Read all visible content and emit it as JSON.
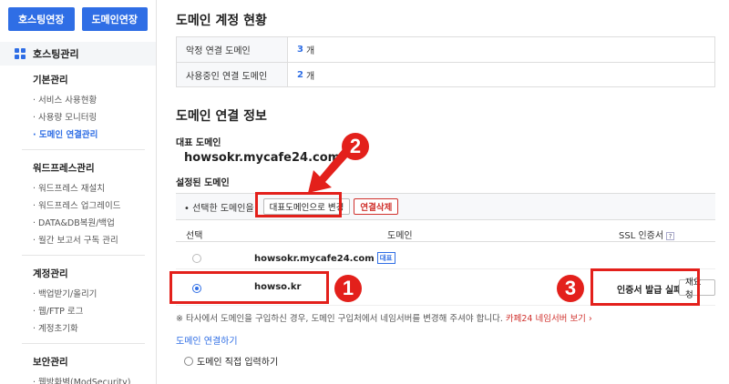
{
  "top_buttons": {
    "hosting_extend": "호스팅연장",
    "domain_extend": "도메인연장"
  },
  "sidebar": {
    "header": "호스팅관리",
    "groups": [
      {
        "title": "기본관리",
        "items": [
          "· 서비스 사용현황",
          "· 사용량 모니터링",
          "· 도메인 연결관리"
        ],
        "active": 2
      },
      {
        "title": "워드프레스관리",
        "items": [
          "· 워드프레스 재설치",
          "· 워드프레스 업그레이드",
          "· DATA&DB복원/백업",
          "· 월간 보고서 구독 관리"
        ]
      },
      {
        "title": "계정관리",
        "items": [
          "· 백업받기/올리기",
          "· 웹/FTP 로그",
          "· 계정초기화"
        ]
      },
      {
        "title": "보안관리",
        "items": [
          "· 웹방화벽(ModSecurity)"
        ]
      }
    ]
  },
  "status": {
    "title": "도메인 계정 현황",
    "rows": [
      {
        "label": "악정 연결 도메인",
        "count": "3",
        "unit": "개"
      },
      {
        "label": "사용중인 연결 도메인",
        "count": "2",
        "unit": "개"
      }
    ]
  },
  "info": {
    "title": "도메인 연결 정보",
    "primary_label": "대표 도메인",
    "primary_domain": "howsokr.mycafe24.com",
    "configured_label": "설정된 도메인",
    "action_prefix": "• 선택한 도메인을",
    "btn_make_primary": "대표도메인으로 변경",
    "btn_delete": "연결삭제",
    "columns": {
      "select": "선택",
      "domain": "도메인",
      "ssl": "SSL 인증서"
    },
    "ssl_help": "?",
    "rows": [
      {
        "domain": "howsokr.mycafe24.com",
        "badge": "대표",
        "selected": false
      },
      {
        "domain": "howso.kr",
        "selected": true,
        "ssl_status": "인증서 발급 실패",
        "ssl_button": "재요청"
      }
    ]
  },
  "annotations": {
    "n1": "1",
    "n2": "2",
    "n3": "3",
    "accent": "#e3201b"
  },
  "note": {
    "text": "※ 타사에서 도메인을 구입하신 경우, 도메인 구입처에서 네임서버를 변경해 주셔야 합니다.",
    "link": "카페24 네임서버 보기 ›"
  },
  "connect": {
    "title": "도메인 연결하기",
    "option": "도메인 직접 입력하기"
  },
  "colors": {
    "brand": "#2f6ee5",
    "alert": "#d0312d"
  }
}
